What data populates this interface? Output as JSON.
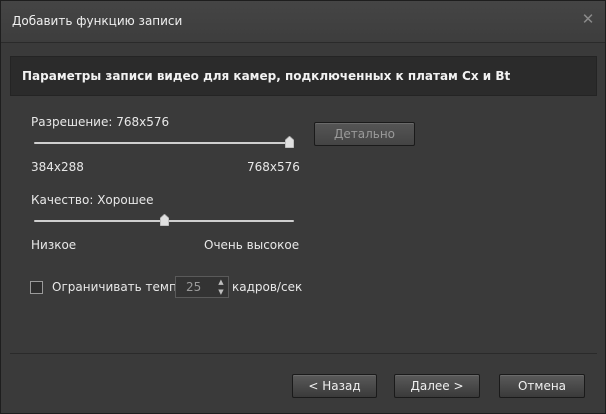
{
  "window": {
    "title": "Добавить функцию записи"
  },
  "header": {
    "text": "Параметры записи видео для камер, подключенных к платам Cx и Bt"
  },
  "resolution": {
    "label": "Разрешение: 768x576",
    "min_label": "384x288",
    "max_label": "768x576",
    "value_fraction": 1.0,
    "details_button": "Детально"
  },
  "quality": {
    "label": "Качество: Хорошее",
    "min_label": "Низкое",
    "max_label": "Очень высокое",
    "value_fraction": 0.5
  },
  "fps_limit": {
    "label": "Ограничивать темп",
    "checked": false,
    "value": "25",
    "unit": "кадров/сек"
  },
  "buttons": {
    "back": "< Назад",
    "next": "Далее >",
    "cancel": "Отмена"
  },
  "icons": {
    "close": "close-icon",
    "slider_thumb": "slider-thumb-icon",
    "spin_up": "arrow-up-icon",
    "spin_down": "arrow-down-icon"
  }
}
